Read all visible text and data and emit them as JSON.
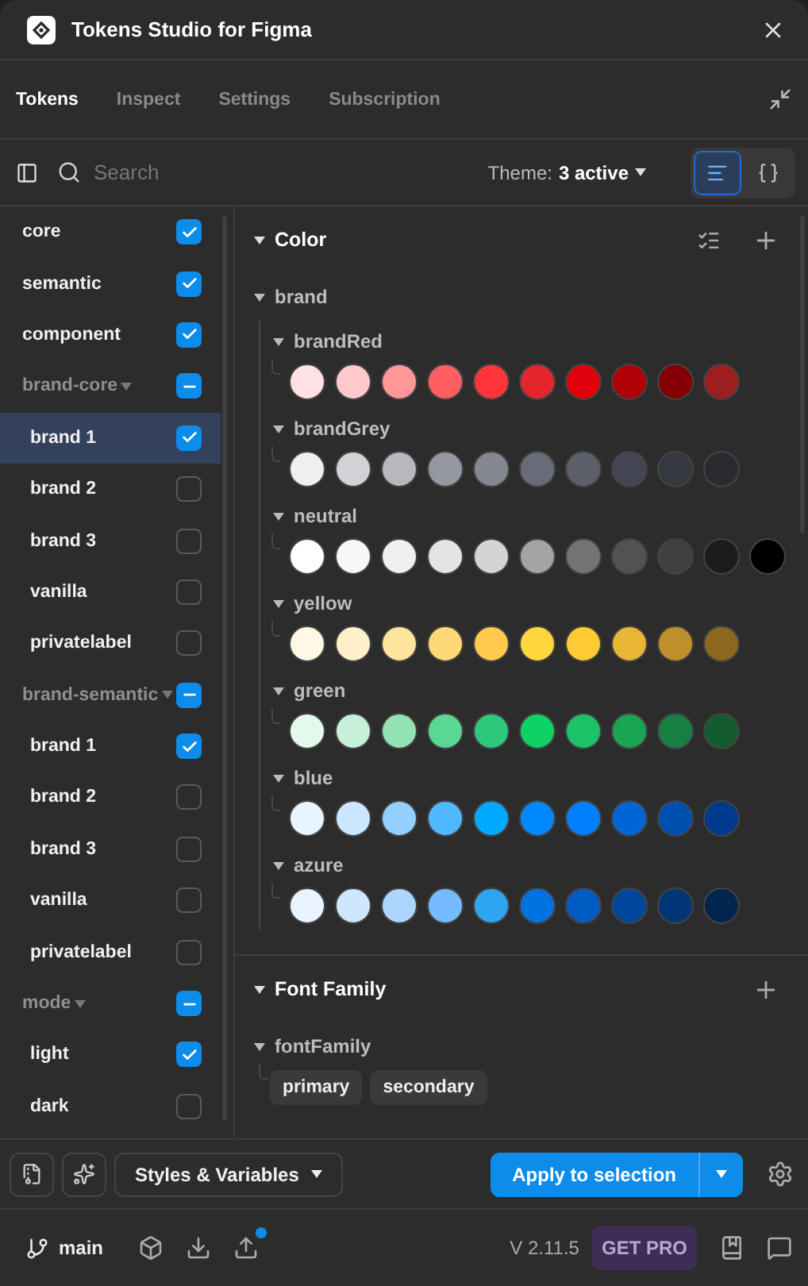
{
  "window": {
    "title": "Tokens Studio for Figma"
  },
  "tabs": [
    {
      "label": "Tokens",
      "selected": true
    },
    {
      "label": "Inspect",
      "selected": false
    },
    {
      "label": "Settings",
      "selected": false
    },
    {
      "label": "Subscription",
      "selected": false
    }
  ],
  "toolbar": {
    "search": {
      "placeholder": "Search"
    },
    "theme_label": "Theme:",
    "theme_value": "3 active",
    "views": [
      {
        "kind": "list",
        "selected": true
      },
      {
        "kind": "json",
        "selected": false
      }
    ]
  },
  "sidebar": {
    "items": [
      {
        "label": "core",
        "checked": true,
        "selected": false
      },
      {
        "label": "semantic",
        "checked": true,
        "selected": false
      },
      {
        "label": "component",
        "checked": true,
        "selected": false
      },
      {
        "label": "brand-core",
        "checked": true,
        "mixed": true,
        "selected": false,
        "children": [
          {
            "label": "brand 1",
            "checked": true,
            "selected": true
          },
          {
            "label": "brand 2",
            "checked": false,
            "selected": false
          },
          {
            "label": "brand 3",
            "checked": false,
            "selected": false
          },
          {
            "label": "vanilla",
            "checked": false,
            "selected": false
          },
          {
            "label": "privatelabel",
            "checked": false,
            "selected": false
          }
        ]
      },
      {
        "label": "brand-semantic",
        "checked": true,
        "mixed": true,
        "selected": false,
        "children": [
          {
            "label": "brand 1",
            "checked": true,
            "selected": false
          },
          {
            "label": "brand 2",
            "checked": false,
            "selected": false
          },
          {
            "label": "brand 3",
            "checked": false,
            "selected": false
          },
          {
            "label": "vanilla",
            "checked": false,
            "selected": false
          },
          {
            "label": "privatelabel",
            "checked": false,
            "selected": false
          }
        ]
      },
      {
        "label": "mode",
        "checked": true,
        "mixed": true,
        "selected": false,
        "children": [
          {
            "label": "light",
            "checked": true,
            "selected": false
          },
          {
            "label": "dark",
            "checked": false,
            "selected": false
          }
        ]
      }
    ]
  },
  "sections": [
    {
      "title": "Color",
      "kind": "color",
      "groups": [
        {
          "label": "brand",
          "children": [
            {
              "label": "brandRed",
              "swatches": [
                {
                  "color": "#ffe1e3"
                },
                {
                  "color": "#ffc9cc"
                },
                {
                  "color": "#ff9799"
                },
                {
                  "color": "#ff5f61"
                },
                {
                  "color": "#ff3539"
                },
                {
                  "color": "#e4252b"
                },
                {
                  "color": "#e0000b"
                },
                {
                  "color": "#b20007"
                },
                {
                  "color": "#840004"
                },
                {
                  "color": "#9c1e1e"
                }
              ]
            },
            {
              "label": "brandGrey",
              "swatches": [
                {
                  "color": "#eeeff1"
                },
                {
                  "color": "#d1d2d6"
                },
                {
                  "color": "#b7b8bd"
                },
                {
                  "color": "#9698a1"
                },
                {
                  "color": "#868891"
                },
                {
                  "color": "#686c78"
                },
                {
                  "color": "#5c5f6a"
                },
                {
                  "color": "#434652"
                },
                {
                  "color": "#363840"
                },
                {
                  "color": "#2a2b30"
                }
              ]
            },
            {
              "label": "neutral",
              "swatches": [
                {
                  "color": "#ffffff"
                },
                {
                  "color": "#f7f7f7"
                },
                {
                  "color": "#f0f0f0"
                },
                {
                  "color": "#e4e4e4"
                },
                {
                  "color": "#d4d4d4"
                },
                {
                  "color": "#a3a3a3"
                },
                {
                  "color": "#737373"
                },
                {
                  "color": "#525252"
                },
                {
                  "color": "#404040"
                },
                {
                  "color": "#1c1c1e"
                },
                {
                  "color": "#000000"
                }
              ]
            },
            {
              "label": "yellow",
              "swatches": [
                {
                  "color": "#fff8e5"
                },
                {
                  "color": "#fff0c7"
                },
                {
                  "color": "#ffe49d"
                },
                {
                  "color": "#ffd876"
                },
                {
                  "color": "#ffca4d"
                },
                {
                  "color": "#ffd63b"
                },
                {
                  "color": "#ffca32"
                },
                {
                  "color": "#e8b535"
                },
                {
                  "color": "#bf902a"
                },
                {
                  "color": "#8c6720"
                }
              ]
            },
            {
              "label": "green",
              "swatches": [
                {
                  "color": "#e4f9ed"
                },
                {
                  "color": "#c6f0d8"
                },
                {
                  "color": "#93e2b4"
                },
                {
                  "color": "#5ad891"
                },
                {
                  "color": "#2dc878"
                },
                {
                  "color": "#0cd163"
                },
                {
                  "color": "#1cc365"
                },
                {
                  "color": "#1aa553"
                },
                {
                  "color": "#177f42"
                },
                {
                  "color": "#125c30"
                }
              ]
            },
            {
              "label": "blue",
              "swatches": [
                {
                  "color": "#e8f4ff"
                },
                {
                  "color": "#cbe7ff"
                },
                {
                  "color": "#93d0ff"
                },
                {
                  "color": "#4fb9ff"
                },
                {
                  "color": "#00aaff"
                },
                {
                  "color": "#0088ff"
                },
                {
                  "color": "#0080ff"
                },
                {
                  "color": "#0066d6"
                },
                {
                  "color": "#0050b0"
                },
                {
                  "color": "#003a8c"
                }
              ]
            },
            {
              "label": "azure",
              "swatches": [
                {
                  "color": "#e8f3ff"
                },
                {
                  "color": "#cfe6ff"
                },
                {
                  "color": "#acd5ff"
                },
                {
                  "color": "#74bbff"
                },
                {
                  "color": "#2fa4f0"
                },
                {
                  "color": "#0073e0"
                },
                {
                  "color": "#005bc0"
                },
                {
                  "color": "#00469a"
                },
                {
                  "color": "#003676"
                },
                {
                  "color": "#00264f"
                }
              ]
            }
          ]
        }
      ]
    },
    {
      "title": "Font Family",
      "kind": "text",
      "groups": [
        {
          "label": "fontFamily",
          "tokens": [
            "primary",
            "secondary"
          ]
        }
      ]
    }
  ],
  "actions": {
    "styles_menu": "Styles & Variables",
    "apply": "Apply to selection"
  },
  "footer": {
    "branch": "main",
    "version": "V 2.11.5",
    "pro": "GET PRO",
    "push_pending": true
  }
}
